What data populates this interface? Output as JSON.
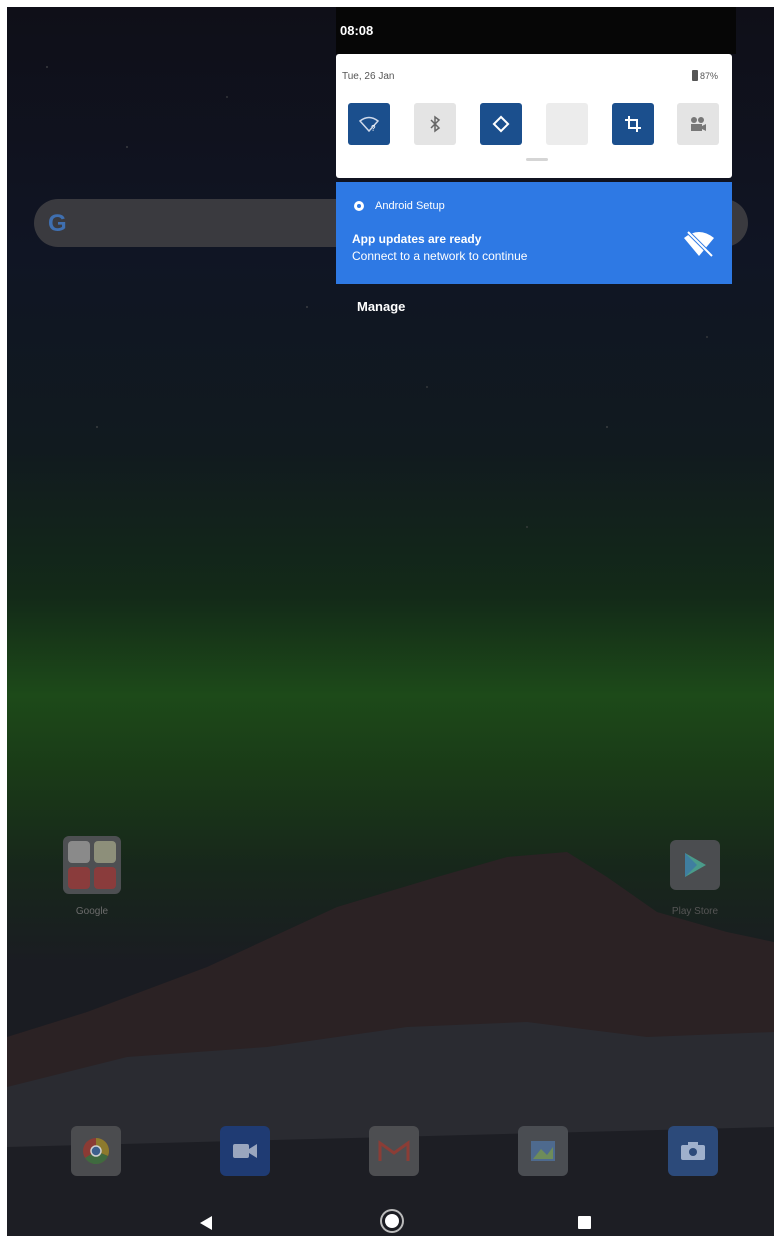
{
  "status_bar": {
    "time": "08:08"
  },
  "quick_settings": {
    "date": "Tue, 26 Jan",
    "battery": "87%",
    "tiles": [
      {
        "name": "wifi",
        "icon": "wifi-question-icon",
        "state": "on"
      },
      {
        "name": "bluetooth",
        "icon": "bluetooth-icon",
        "state": "off"
      },
      {
        "name": "auto-rotate",
        "icon": "rotate-icon",
        "state": "on"
      },
      {
        "name": "unknown",
        "icon": "blank-tile",
        "state": "off"
      },
      {
        "name": "screenshot",
        "icon": "crop-icon",
        "state": "on"
      },
      {
        "name": "screen-record",
        "icon": "screen-record-icon",
        "state": "off"
      }
    ]
  },
  "notification": {
    "app": "Android Setup",
    "title": "App updates are ready",
    "text": "Connect to a network to continue",
    "icon": "wifi-off-icon"
  },
  "manage_label": "Manage",
  "home": {
    "folder_label": "Google",
    "play_store_label": "Play Store",
    "dock": [
      "chrome",
      "duo",
      "gmail",
      "files",
      "camera"
    ]
  },
  "colors": {
    "notification_bg": "#2e79e4",
    "tile_on": "#1b4f8d",
    "tile_off": "#e4e4e4"
  }
}
